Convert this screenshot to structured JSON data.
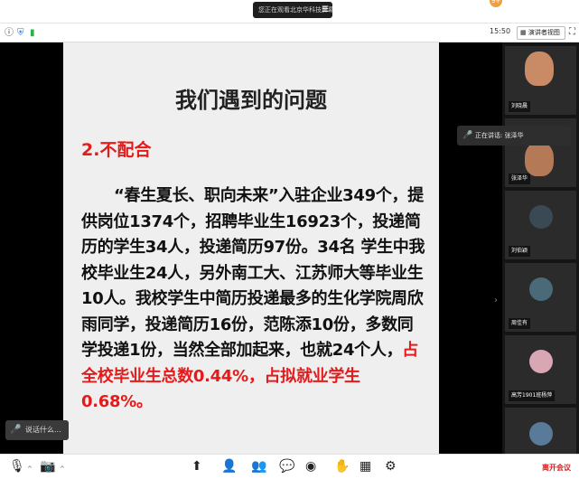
{
  "top_pill": {
    "text": "您正在观看北京华科技屏幕",
    "menu_icon": "menu-icon"
  },
  "notification_badge": "9+",
  "infobar": {
    "time": "15:50",
    "view_label": "演讲者视图",
    "icons": [
      "info-icon",
      "shield-icon",
      "signal-icon"
    ]
  },
  "slide": {
    "title": "我们遇到的问题",
    "subtitle": "2.不配合",
    "body": "“春生夏长、职向未来”入驻企业349个，提供岗位1374个，招聘毕业生16923个，投递简历的学生34人，投递简历97份。34名 学生中我校毕业生24人，另外南工大、江苏师大等毕业生10人。我校学生中简历投递最多的生化学院周欣雨同学，投递简历16份，范陈添10份，多数同学投递1份，当然全部加起来，也就24个人，",
    "body_red": "占全校毕业生总数0.44%，占拟就业学生0.68%。"
  },
  "speaker_tag": "说话什么...",
  "tooltip": "正在讲话: 张泽华",
  "participants": [
    {
      "name": "刘晓晨",
      "kind": "video",
      "bg": "#8a7a66"
    },
    {
      "name": "张泽华",
      "kind": "video",
      "bg": "#6e6e6e"
    },
    {
      "name": "刘伯颖",
      "kind": "avatar",
      "bg": "#3a4a55"
    },
    {
      "name": "周佳有",
      "kind": "avatar",
      "bg": "#4a6a7a"
    },
    {
      "name": "高芳1901班杨萍",
      "kind": "avatar",
      "bg": "#d9a7b4"
    },
    {
      "name": "",
      "kind": "avatar",
      "bg": "#5a7a9a"
    }
  ],
  "toolbar": {
    "buttons": [
      "mic-icon",
      "video-off-icon",
      "share-screen-icon",
      "invite-icon",
      "participants-icon",
      "chat-icon",
      "record-icon",
      "raise-hand-icon",
      "apps-icon",
      "settings-icon"
    ],
    "leave_label": "离开会议"
  }
}
